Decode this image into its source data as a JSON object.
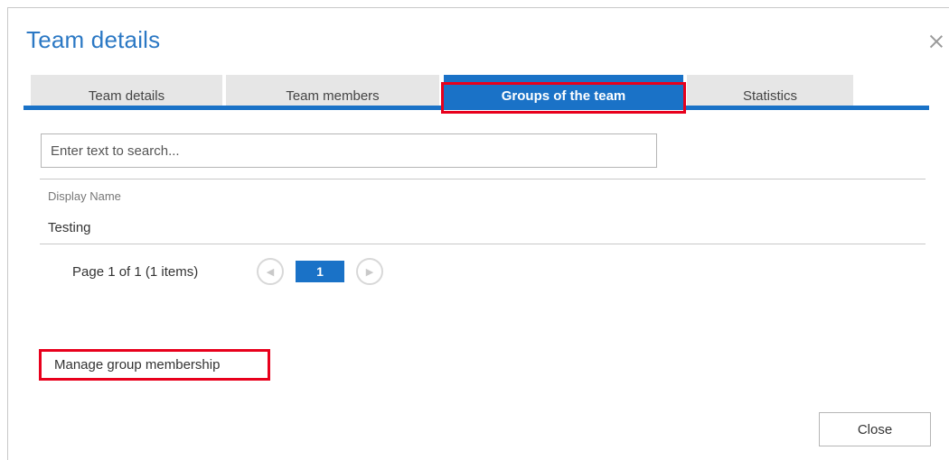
{
  "dialog": {
    "title": "Team details",
    "close_icon": "close-icon"
  },
  "tabs": [
    {
      "label": "Team details"
    },
    {
      "label": "Team members"
    },
    {
      "label": "Groups of the team",
      "active": true
    },
    {
      "label": "Statistics"
    }
  ],
  "colors": {
    "accent": "#1a72c7",
    "title": "#2b78c4",
    "highlight": "#e8001c"
  },
  "search": {
    "placeholder": "Enter text to search...",
    "value": ""
  },
  "grid": {
    "column_header": "Display Name",
    "rows": [
      {
        "display_name": "Testing"
      }
    ]
  },
  "pager": {
    "summary": "Page 1 of 1 (1 items)",
    "current_page": "1",
    "prev_icon": "chevron-left-icon",
    "next_icon": "chevron-right-icon"
  },
  "actions": {
    "manage_label": "Manage group membership",
    "close_label": "Close"
  }
}
